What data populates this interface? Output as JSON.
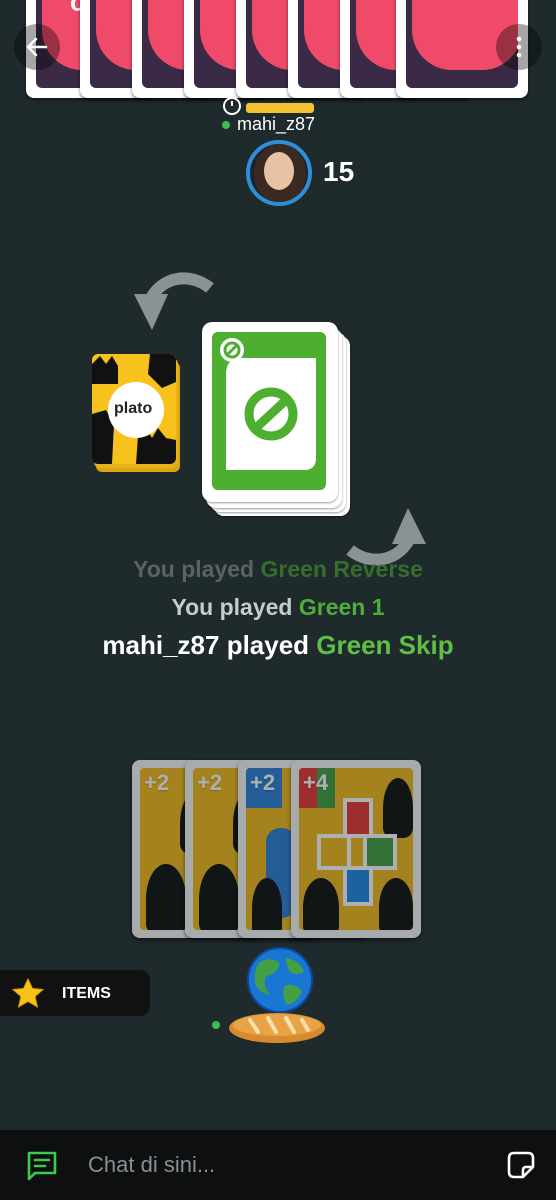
{
  "opponent": {
    "name": "mahi_z87",
    "card_count": "15",
    "card_logo": "plato"
  },
  "deck": {
    "logo": "plato"
  },
  "log": {
    "line1_prefix": "You played ",
    "line1_card": "Green Reverse",
    "line2_prefix": "You played ",
    "line2_card": "Green 1",
    "line3_prefix": "mahi_z87 played ",
    "line3_card": "Green Skip"
  },
  "hand": {
    "cards": [
      {
        "label": "+2"
      },
      {
        "label": "+2"
      },
      {
        "label": "+2"
      },
      {
        "label": "+4"
      }
    ]
  },
  "items": {
    "label": "ITEMS"
  },
  "chat": {
    "placeholder": "Chat di sini..."
  },
  "colors": {
    "background": "#1f2a2d",
    "green": "#4caf2f",
    "yellow": "#f4c430",
    "avatar_ring": "#2d8fd9",
    "card_back": "#ef4a6a"
  }
}
